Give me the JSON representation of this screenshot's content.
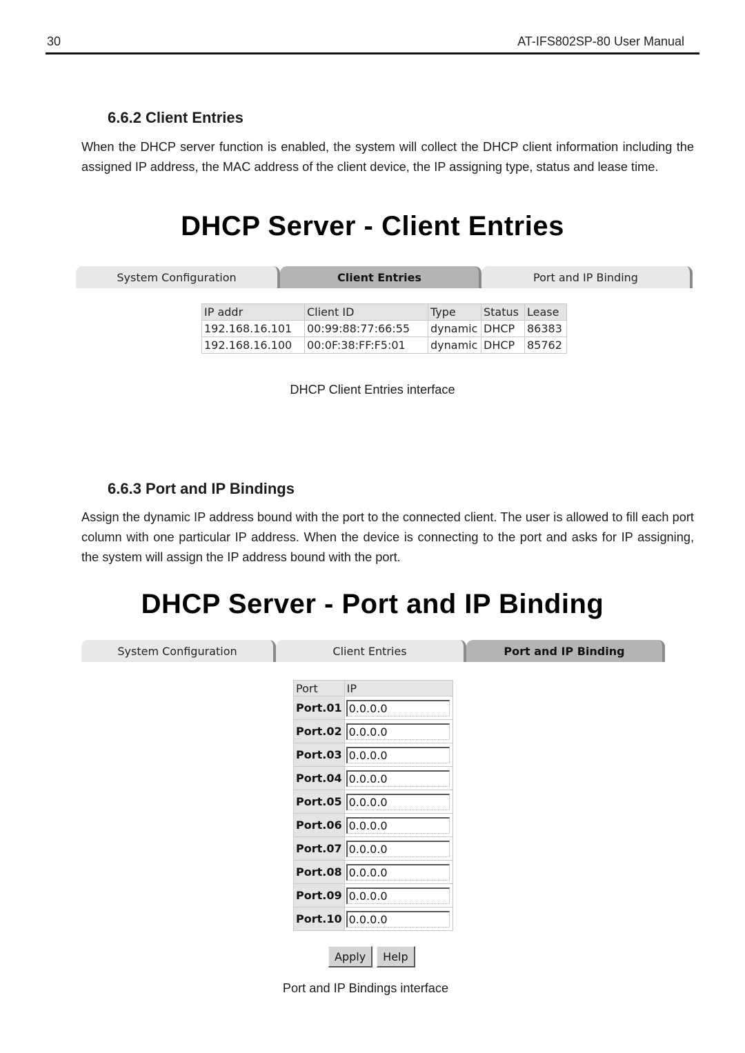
{
  "page_header": {
    "page_number": "30",
    "manual_title": "AT-IFS802SP-80 User Manual"
  },
  "section_client_entries": {
    "heading": "6.6.2  Client Entries",
    "paragraph": "When the DHCP server function is enabled, the system will collect the DHCP client information including the assigned IP address, the MAC address of the client device, the IP assigning type, status and lease time.",
    "screen_title": "DHCP Server - Client Entries",
    "tabs": [
      {
        "label": "System Configuration",
        "active": false
      },
      {
        "label": "Client Entries",
        "active": true
      },
      {
        "label": "Port and IP Binding",
        "active": false
      }
    ],
    "table": {
      "columns": [
        "IP addr",
        "Client ID",
        "Type",
        "Status",
        "Lease"
      ],
      "rows": [
        [
          "192.168.16.101",
          "00:99:88:77:66:55",
          "dynamic",
          "DHCP",
          "86383"
        ],
        [
          "192.168.16.100",
          "00:0F:38:FF:F5:01",
          "dynamic",
          "DHCP",
          "85762"
        ]
      ]
    },
    "caption": "DHCP Client Entries interface"
  },
  "section_port_ip_bindings": {
    "heading": "6.6.3  Port and IP Bindings",
    "paragraph": "Assign the dynamic IP address bound with the port to the connected client. The user is allowed to fill each port column with one particular IP address. When the device is connecting to the port and asks for IP assigning, the system will assign the IP address bound with the port.",
    "screen_title": "DHCP Server - Port and IP Binding",
    "tabs": [
      {
        "label": "System Configuration",
        "active": false
      },
      {
        "label": "Client Entries",
        "active": false
      },
      {
        "label": "Port and IP Binding",
        "active": true
      }
    ],
    "table": {
      "columns": [
        "Port",
        "IP"
      ],
      "rows": [
        {
          "port": "Port.01",
          "ip": "0.0.0.0"
        },
        {
          "port": "Port.02",
          "ip": "0.0.0.0"
        },
        {
          "port": "Port.03",
          "ip": "0.0.0.0"
        },
        {
          "port": "Port.04",
          "ip": "0.0.0.0"
        },
        {
          "port": "Port.05",
          "ip": "0.0.0.0"
        },
        {
          "port": "Port.06",
          "ip": "0.0.0.0"
        },
        {
          "port": "Port.07",
          "ip": "0.0.0.0"
        },
        {
          "port": "Port.08",
          "ip": "0.0.0.0"
        },
        {
          "port": "Port.09",
          "ip": "0.0.0.0"
        },
        {
          "port": "Port.10",
          "ip": "0.0.0.0"
        }
      ]
    },
    "buttons": {
      "apply": "Apply",
      "help": "Help"
    },
    "caption": "Port and IP Bindings interface"
  }
}
